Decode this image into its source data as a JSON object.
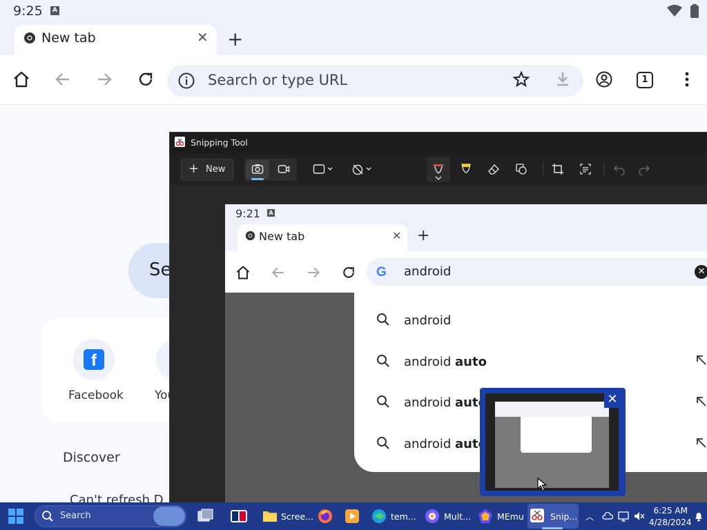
{
  "status_bar": {
    "time": "9:25",
    "badge": "A"
  },
  "chrome": {
    "tab_title": "New tab",
    "omnibox_placeholder": "Search or type URL",
    "tab_count": "1"
  },
  "ntp": {
    "search_partial": "Se",
    "shortcuts": [
      {
        "label": "Facebook"
      },
      {
        "label": "You"
      }
    ],
    "discover": "Discover",
    "cant_refresh": "Can't refresh D"
  },
  "snipping_tool": {
    "title": "Snipping Tool",
    "new_label": "New"
  },
  "inner_screenshot": {
    "time": "9:21",
    "badge": "A",
    "tab_title": "New tab",
    "omnibox_text": "android",
    "suggestions": [
      {
        "prefix": "android",
        "bold": ""
      },
      {
        "prefix": "android ",
        "bold": "auto"
      },
      {
        "prefix": "android ",
        "bold": "auto"
      },
      {
        "prefix": "android ",
        "bold": "auto"
      }
    ]
  },
  "taskbar": {
    "search_placeholder": "Search",
    "apps": [
      {
        "label": "Scree..."
      },
      {
        "label": "tem..."
      },
      {
        "label": "Mult..."
      },
      {
        "label": "MEmu"
      },
      {
        "label": "Snip..."
      }
    ],
    "clock_time": "6:25 AM",
    "clock_date": "4/28/2024"
  },
  "colors": {
    "accent": "#1f3a8a",
    "snip_bg": "#202020",
    "chrome_bg": "#eef1fa",
    "taskbar": "#1f3a8a"
  }
}
